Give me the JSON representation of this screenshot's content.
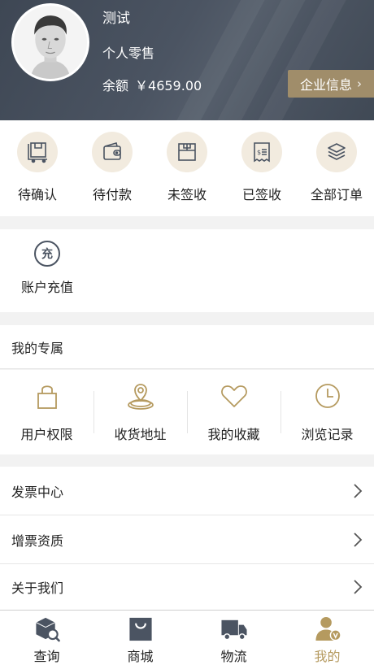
{
  "header": {
    "user_name": "测试",
    "user_type": "个人零售",
    "balance_label": "余额",
    "balance_value": "￥4659.00",
    "company_button": "企业信息"
  },
  "orders": [
    {
      "label": "待确认",
      "icon": "box-pending-icon"
    },
    {
      "label": "待付款",
      "icon": "wallet-icon"
    },
    {
      "label": "未签收",
      "icon": "package-icon"
    },
    {
      "label": "已签收",
      "icon": "receipt-icon"
    },
    {
      "label": "全部订单",
      "icon": "layers-icon"
    }
  ],
  "recharge": {
    "icon_text": "充",
    "label": "账户充值"
  },
  "exclusive": {
    "title": "我的专属",
    "items": [
      {
        "label": "用户权限",
        "icon": "lock-icon"
      },
      {
        "label": "收货地址",
        "icon": "location-icon"
      },
      {
        "label": "我的收藏",
        "icon": "heart-icon"
      },
      {
        "label": "浏览记录",
        "icon": "clock-icon"
      }
    ]
  },
  "list": [
    {
      "label": "发票中心"
    },
    {
      "label": "增票资质"
    },
    {
      "label": "关于我们"
    }
  ],
  "tabbar": [
    {
      "label": "查询",
      "icon": "search-box-icon"
    },
    {
      "label": "商城",
      "icon": "shopping-bag-icon"
    },
    {
      "label": "物流",
      "icon": "truck-icon"
    },
    {
      "label": "我的",
      "icon": "user-vip-icon",
      "active": true
    }
  ],
  "colors": {
    "header_bg": "#4b5462",
    "accent_gold": "#b59a5f",
    "company_button_bg": "#a08d6a",
    "icon_circle_bg": "#f2ebdf"
  }
}
